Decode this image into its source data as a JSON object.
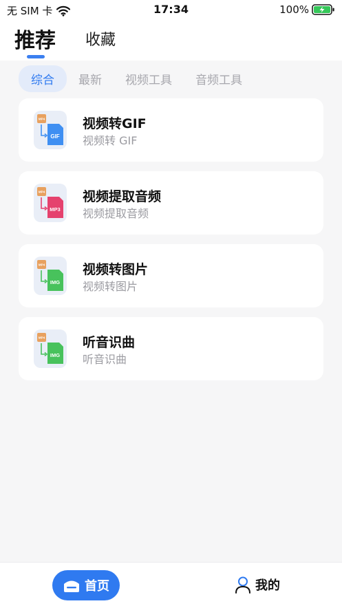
{
  "status_bar": {
    "carrier": "无 SIM 卡",
    "time": "17:34",
    "battery": "100%"
  },
  "header": {
    "tabs": [
      {
        "label": "推荐",
        "active": true
      },
      {
        "label": "收藏",
        "active": false
      }
    ]
  },
  "filters": [
    {
      "label": "综合",
      "active": true
    },
    {
      "label": "最新",
      "active": false
    },
    {
      "label": "视频工具",
      "active": false
    },
    {
      "label": "音频工具",
      "active": false
    }
  ],
  "tools": [
    {
      "title": "视频转GIF",
      "subtitle": "视频转 GIF",
      "icon": "video-to-gif-icon",
      "badge": "GIF",
      "color": "#3f8ff2"
    },
    {
      "title": "视频提取音频",
      "subtitle": "视频提取音频",
      "icon": "video-to-mp3-icon",
      "badge": "MP3",
      "color": "#e5426e"
    },
    {
      "title": "视频转图片",
      "subtitle": "视频转图片",
      "icon": "video-to-image-icon",
      "badge": "IMG",
      "color": "#48c25c"
    },
    {
      "title": "听音识曲",
      "subtitle": "听音识曲",
      "icon": "music-recognition-icon",
      "badge": "IMG",
      "color": "#48c25c"
    }
  ],
  "bottom_tabs": {
    "home": "首页",
    "mine": "我的"
  },
  "colors": {
    "accent": "#2f7af0",
    "mp4_badge": "#e8a15f"
  }
}
